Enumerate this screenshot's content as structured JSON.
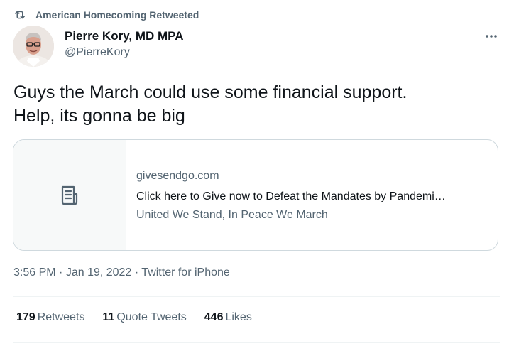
{
  "retweet": {
    "icon": "retweet-icon",
    "text": "American Homecoming Retweeted"
  },
  "author": {
    "name": "Pierre Kory, MD MPA",
    "handle": "@PierreKory",
    "avatar_icon": "avatar-photo"
  },
  "more_icon": "more-options-icon",
  "tweet": {
    "lines": [
      "Guys the March could use some financial support.",
      "Help, its gonna be big"
    ]
  },
  "card": {
    "thumb_icon": "document-icon",
    "domain": "givesendgo.com",
    "title": "Click here to Give now to Defeat the Mandates by Pandemi…",
    "description": "United We Stand, In Peace We March"
  },
  "meta": {
    "time": "3:56 PM",
    "separator": "·",
    "date": "Jan 19, 2022",
    "source": "Twitter for iPhone"
  },
  "stats": [
    {
      "count": "179",
      "label": "Retweets"
    },
    {
      "count": "11",
      "label": "Quote Tweets"
    },
    {
      "count": "446",
      "label": "Likes"
    }
  ],
  "colors": {
    "text_primary": "#0f1419",
    "text_secondary": "#536471",
    "border": "#cfd9de",
    "divider": "#eff3f4",
    "thumb_bg": "#f7f9f9"
  }
}
